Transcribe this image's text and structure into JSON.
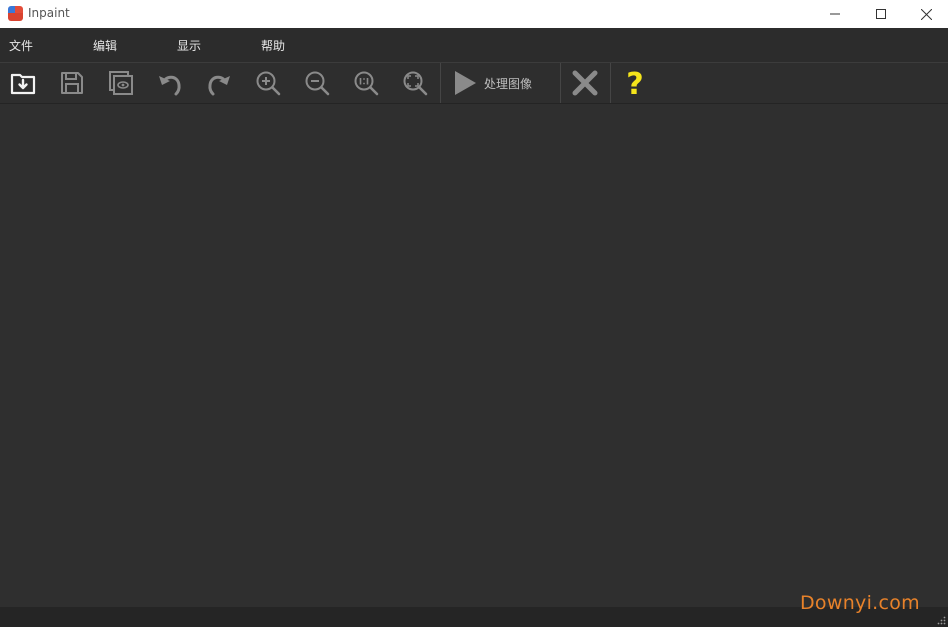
{
  "window": {
    "title": "Inpaint"
  },
  "menu": {
    "items": [
      {
        "label": "文件"
      },
      {
        "label": "编辑"
      },
      {
        "label": "显示"
      },
      {
        "label": "帮助"
      }
    ]
  },
  "toolbar": {
    "process_label": "处理图像",
    "help_glyph": "?",
    "icons": [
      "open-icon",
      "save-icon",
      "preview-icon",
      "undo-icon",
      "redo-icon",
      "zoom-in-icon",
      "zoom-out-icon",
      "zoom-actual-icon",
      "zoom-fit-icon",
      "play-icon",
      "close-icon",
      "help-icon"
    ]
  },
  "watermark": {
    "text": "Downyi.com"
  },
  "colors": {
    "canvas": "#2f2f2f",
    "menubar": "#2c2c2c",
    "toolbar": "#2e2e2e",
    "help_accent": "#f5e51b",
    "watermark": "#e8822a"
  }
}
